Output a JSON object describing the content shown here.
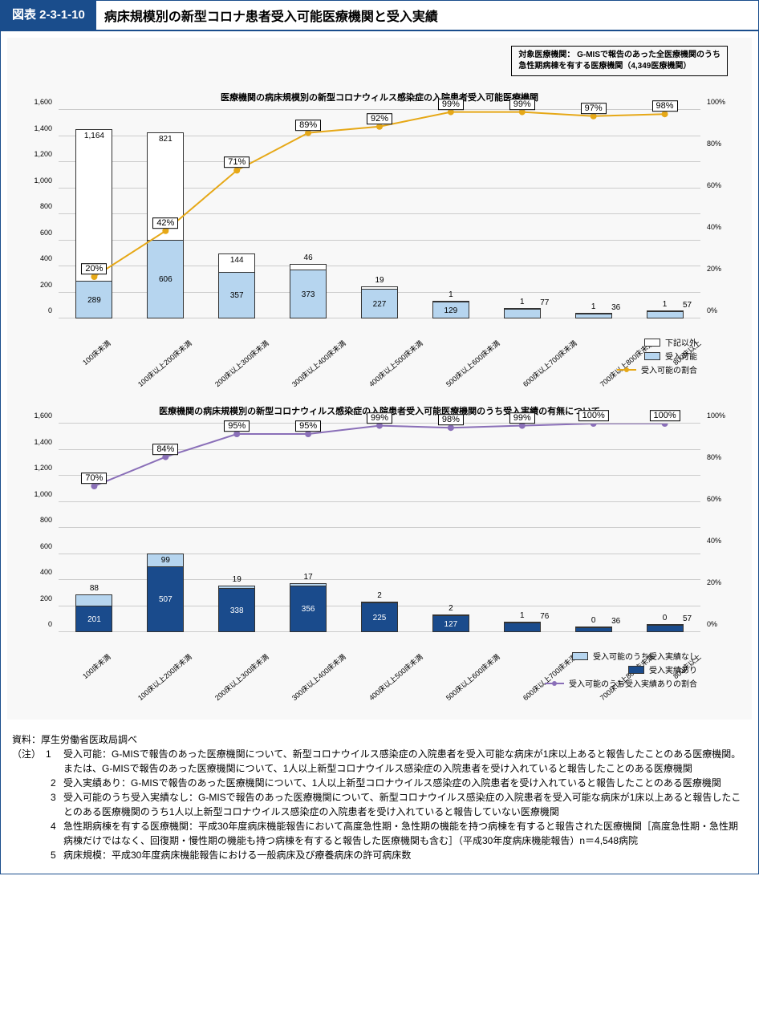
{
  "header": {
    "tag": "図表 2-3-1-10",
    "title": "病床規模別の新型コロナ患者受入可能医療機関と受入実績"
  },
  "note_box": {
    "line1": "対象医療機関：  G-MISで報告のあった全医療機関のうち",
    "line2": "急性期病棟を有する医療機関（4,349医療機関）"
  },
  "chart_data": [
    {
      "type": "bar",
      "title": "医療機関の病床規模別の新型コロナウィルス感染症の入院患者受入可能医療機関",
      "categories": [
        "100床未満",
        "100床以上200床未満",
        "200床以上300床未満",
        "300床以上400床未満",
        "400床以上500床未満",
        "500床以上600床未満",
        "600床以上700床未満",
        "700床以上800床未満",
        "800床以上"
      ],
      "series": [
        {
          "name": "受入可能",
          "values": [
            289,
            606,
            357,
            373,
            227,
            129,
            77,
            36,
            57
          ]
        },
        {
          "name": "下記以外",
          "values": [
            1164,
            821,
            144,
            46,
            19,
            1,
            1,
            1,
            1
          ]
        }
      ],
      "line": {
        "name": "受入可能の割合",
        "values": [
          20,
          42,
          71,
          89,
          92,
          99,
          99,
          97,
          98
        ]
      },
      "ylabel": "",
      "xlabel": "",
      "ylim": [
        0,
        1600
      ],
      "ylim_right": [
        0,
        100
      ],
      "legend": [
        "下記以外",
        "受入可能",
        "受入可能の割合"
      ]
    },
    {
      "type": "bar",
      "title": "医療機関の病床規模別の新型コロナウィルス感染症の入院患者受入可能医療機関のうち受入実績の有無について",
      "categories": [
        "100床未満",
        "100床以上200床未満",
        "200床以上300床未満",
        "300床以上400床未満",
        "400床以上500床未満",
        "500床以上600床未満",
        "600床以上700床未満",
        "700床以上800床未満",
        "800床以上"
      ],
      "series": [
        {
          "name": "受入実績あり",
          "values": [
            201,
            507,
            338,
            356,
            225,
            127,
            76,
            36,
            57
          ]
        },
        {
          "name": "受入可能のうち受入実績なし",
          "values": [
            88,
            99,
            19,
            17,
            2,
            2,
            1,
            0,
            0
          ]
        }
      ],
      "line": {
        "name": "受入可能のうち受入実績ありの割合",
        "values": [
          70,
          84,
          95,
          95,
          99,
          98,
          99,
          100,
          100
        ]
      },
      "ylabel": "",
      "xlabel": "",
      "ylim": [
        0,
        1600
      ],
      "ylim_right": [
        0,
        100
      ],
      "legend": [
        "受入可能のうち受入実績なし",
        "受入実績あり",
        "受入可能のうち受入実績ありの割合"
      ]
    }
  ],
  "y_ticks_left": [
    0,
    200,
    400,
    600,
    800,
    1000,
    1200,
    1400,
    1600
  ],
  "y_ticks_right": [
    "0%",
    "20%",
    "40%",
    "60%",
    "80%",
    "100%"
  ],
  "footer": {
    "source": "資料：厚生労働省医政局調べ",
    "notes_label": "（注）",
    "notes": [
      {
        "n": "1",
        "t": "受入可能：G-MISで報告のあった医療機関について、新型コロナウイルス感染症の入院患者を受入可能な病床が1床以上あると報告したことのある医療機関。または、G-MISで報告のあった医療機関について、1人以上新型コロナウイルス感染症の入院患者を受け入れていると報告したことのある医療機関"
      },
      {
        "n": "2",
        "t": "受入実績あり：G-MISで報告のあった医療機関について、1人以上新型コロナウイルス感染症の入院患者を受け入れていると報告したことのある医療機関"
      },
      {
        "n": "3",
        "t": "受入可能のうち受入実績なし：G-MISで報告のあった医療機関について、新型コロナウイルス感染症の入院患者を受入可能な病床が1床以上あると報告したことのある医療機関のうち1人以上新型コロナウイルス感染症の入院患者を受け入れていると報告していない医療機関"
      },
      {
        "n": "4",
        "t": "急性期病棟を有する医療機関：平成30年度病床機能報告において高度急性期・急性期の機能を持つ病棟を有すると報告された医療機関［高度急性期・急性期病棟だけではなく、回復期・慢性期の機能も持つ病棟を有すると報告した医療機関も含む］（平成30年度病床機能報告）n＝4,548病院"
      },
      {
        "n": "5",
        "t": "病床規模：平成30年度病床機能報告における一般病床及び療養病床の許可病床数"
      }
    ]
  }
}
